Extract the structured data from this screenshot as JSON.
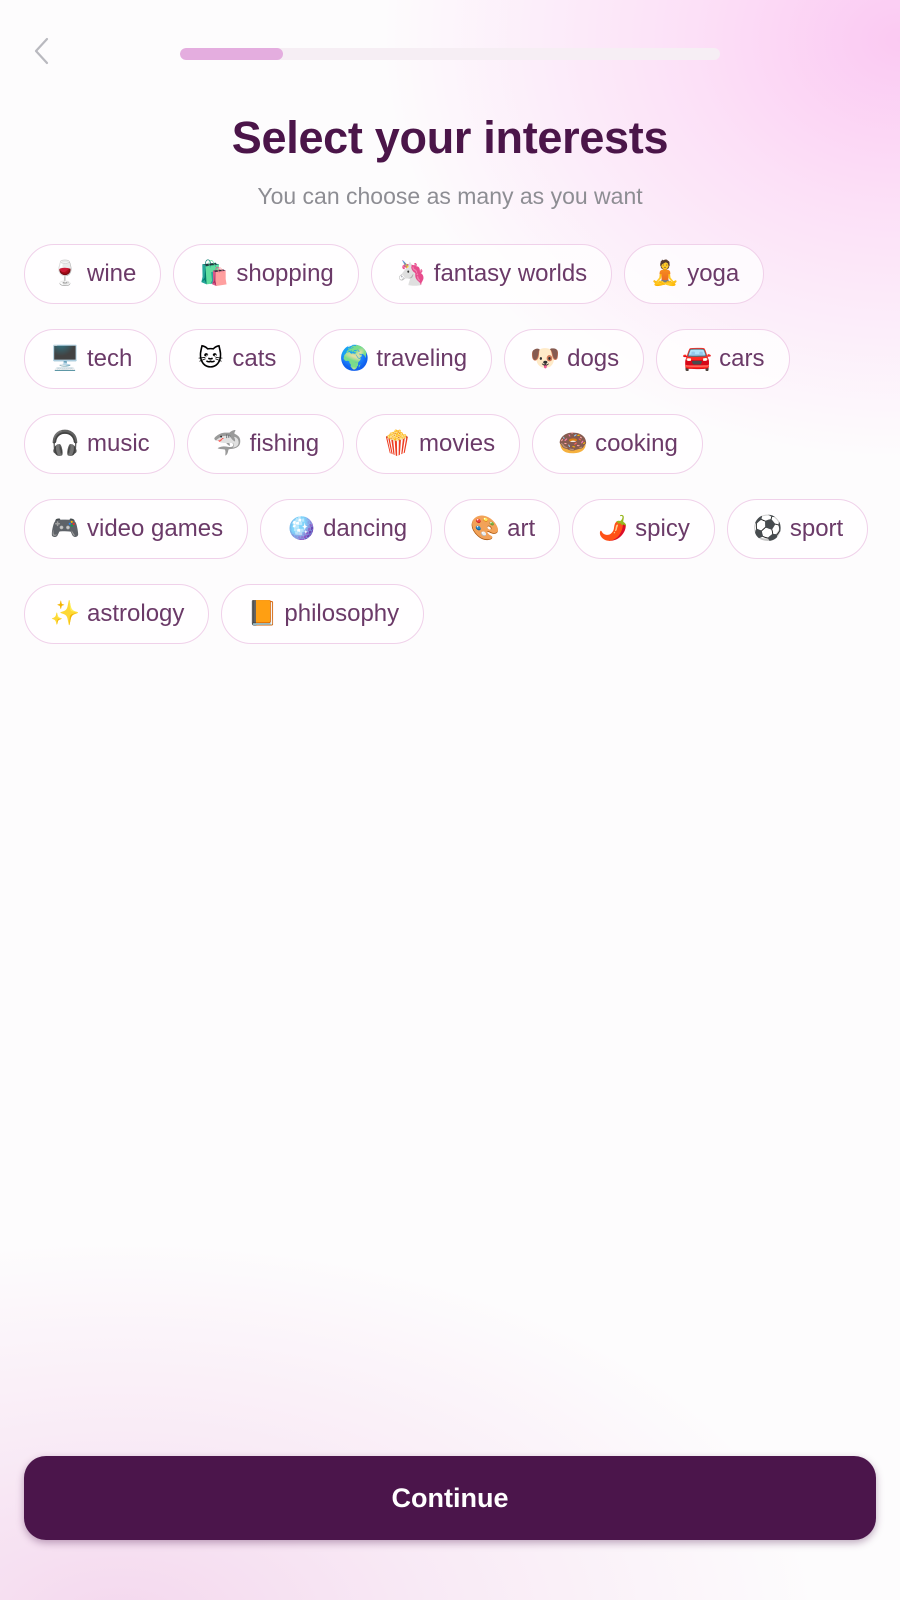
{
  "header": {
    "back_icon": "chevron-left-icon",
    "progress": 0.19
  },
  "title": "Select your interests",
  "subtitle": "You can choose as many as you want",
  "interests": [
    {
      "emoji": "🍷",
      "label": "wine"
    },
    {
      "emoji": "🛍️",
      "label": "shopping"
    },
    {
      "emoji": "🦄",
      "label": "fantasy worlds"
    },
    {
      "emoji": "🧘",
      "label": "yoga"
    },
    {
      "emoji": "🖥️",
      "label": "tech"
    },
    {
      "emoji": "🐱",
      "label": "cats"
    },
    {
      "emoji": "🌍",
      "label": "traveling"
    },
    {
      "emoji": "🐶",
      "label": "dogs"
    },
    {
      "emoji": "🚘",
      "label": "cars"
    },
    {
      "emoji": "🎧",
      "label": "music"
    },
    {
      "emoji": "🦈",
      "label": "fishing"
    },
    {
      "emoji": "🍿",
      "label": "movies"
    },
    {
      "emoji": "🍩",
      "label": "cooking"
    },
    {
      "emoji": "🎮",
      "label": "video games"
    },
    {
      "emoji": "🪩",
      "label": "dancing"
    },
    {
      "emoji": "🎨",
      "label": "art"
    },
    {
      "emoji": "🌶️",
      "label": "spicy"
    },
    {
      "emoji": "⚽",
      "label": "sport"
    },
    {
      "emoji": "✨",
      "label": "astrology"
    },
    {
      "emoji": "📙",
      "label": "philosophy"
    }
  ],
  "continue_label": "Continue",
  "colors": {
    "title": "#4b1549",
    "accent": "#4b154b",
    "progress_fill": "#e4addf",
    "chip_border": "#f0d1ea",
    "chip_text": "#6b3a68"
  }
}
